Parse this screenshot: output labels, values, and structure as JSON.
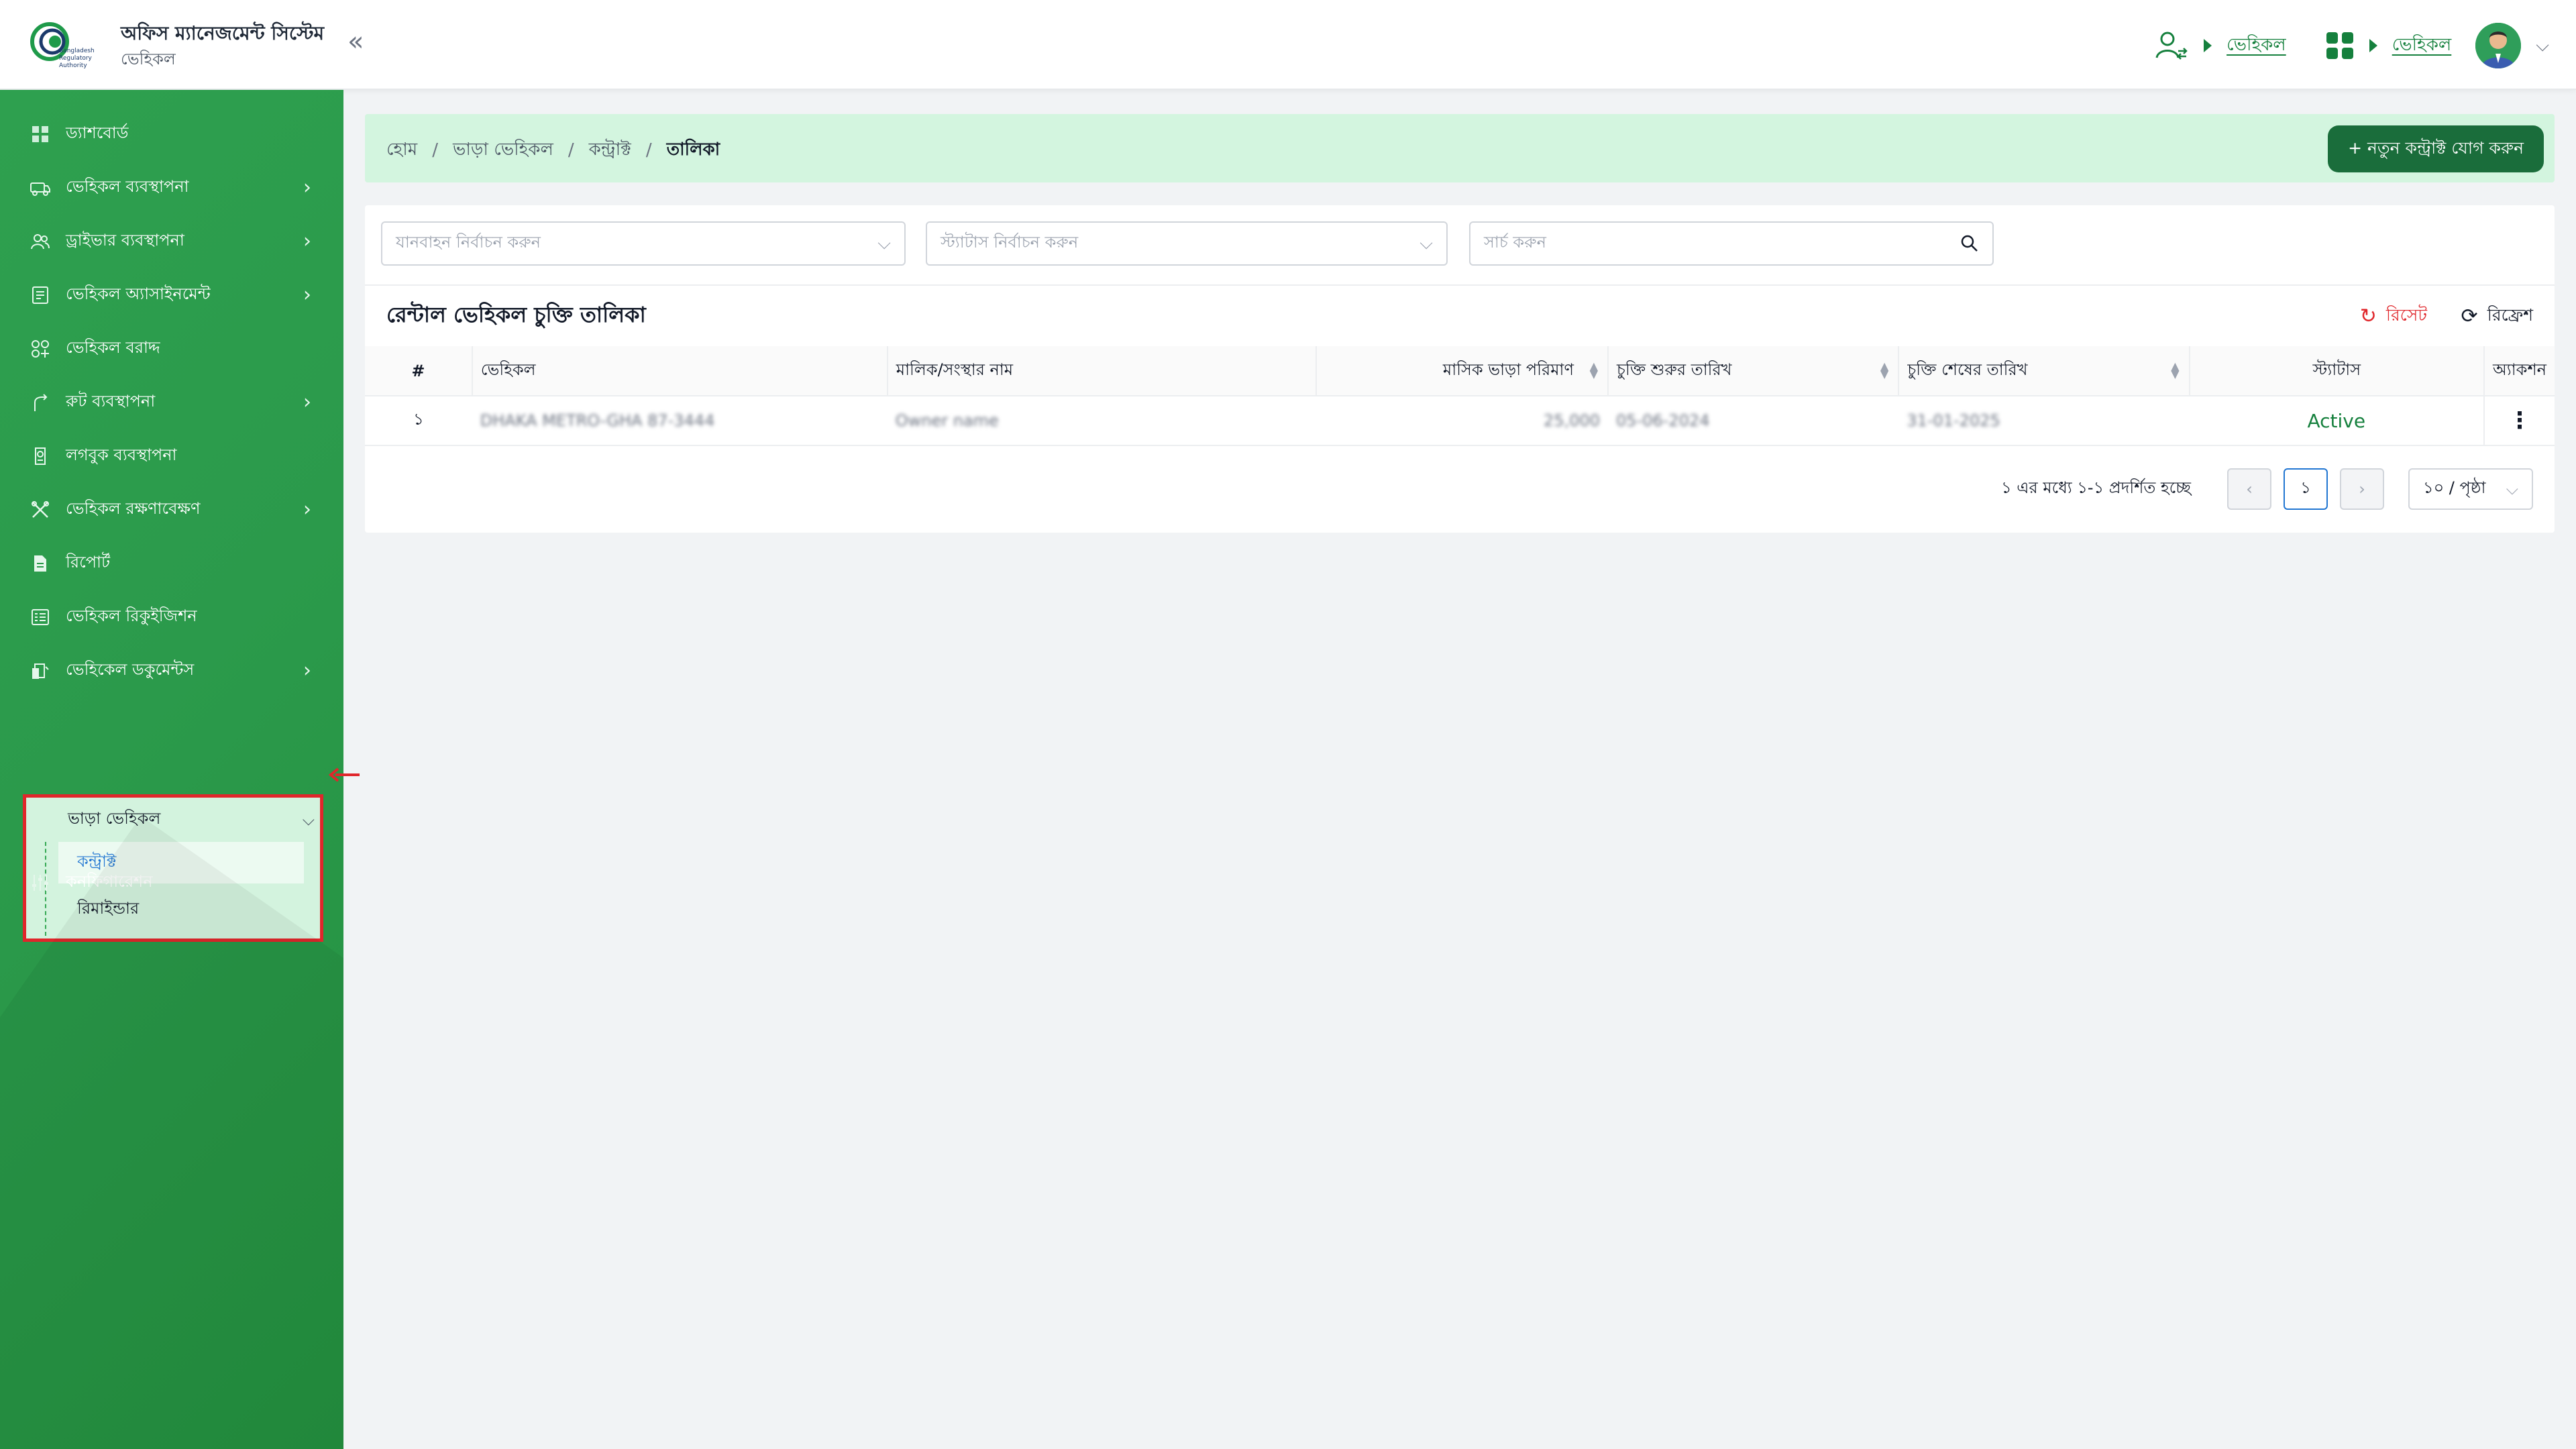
{
  "app": {
    "title": "অফিস ম্যানেজমেন্ট সিস্টেম",
    "subtitle": "ভেহিকল",
    "logo_text": [
      "Bangladesh",
      "Regulatory",
      "Authority"
    ]
  },
  "header": {
    "link1": "ভেহিকল",
    "link2": "ভেহিকল",
    "accent": "#15803d"
  },
  "sidebar": {
    "items": [
      {
        "label": "ড্যাশবোর্ড",
        "icon": "dashboard-icon"
      },
      {
        "label": "ভেহিকল ব্যবস্থাপনা",
        "icon": "car-icon"
      },
      {
        "label": "ড্রাইভার ব্যবস্থাপনা",
        "icon": "users-icon"
      },
      {
        "label": "ভেহিকল অ্যাসাইনমেন্ট",
        "icon": "clipboard-icon"
      },
      {
        "label": "ভেহিকল বরাদ্দ",
        "icon": "grid-plus-icon"
      },
      {
        "label": "রুট ব্যবস্থাপনা",
        "icon": "route-icon"
      },
      {
        "label": "লগবুক ব্যবস্থাপনা",
        "icon": "logbook-icon"
      },
      {
        "label": "ভেহিকল রক্ষণাবেক্ষণ",
        "icon": "tools-icon"
      },
      {
        "label": "রিপোর্ট",
        "icon": "report-icon"
      },
      {
        "label": "ভেহিকল রিকুইজিশন",
        "icon": "requisition-icon"
      },
      {
        "label": "ভেহিকেল ডকুমেন্টস",
        "icon": "documents-icon"
      }
    ],
    "rental": {
      "label": "ভাড়া ভেহিকল",
      "sub": [
        "কন্ট্রাক্ট",
        "রিমাইন্ডার"
      ]
    },
    "config": "কনফিগারেশন"
  },
  "breadcrumb": [
    "হোম",
    "ভাড়া ভেহিকল",
    "কন্ট্রাক্ট",
    "তালিকা"
  ],
  "add_button": "+ নতুন কন্ট্রাক্ট যোগ করুন",
  "filters": {
    "vehicle_placeholder": "যানবাহন নির্বাচন করুন",
    "status_placeholder": "স্ট্যাটাস নির্বাচন করুন",
    "search_placeholder": "সার্চ করুন"
  },
  "table": {
    "title": "রেন্টাল ভেহিকল চুক্তি তালিকা",
    "reset": "রিসেট",
    "refresh": "রিফ্রেশ",
    "columns": [
      "#",
      "ভেহিকল",
      "মালিক/সংস্থার নাম",
      "মাসিক ভাড়া পরিমাণ",
      "চুক্তি শুরুর তারিখ",
      "চুক্তি শেষের তারিখ",
      "স্ট্যাটাস",
      "অ্যাকশন"
    ],
    "rows": [
      {
        "num": "১",
        "vehicle": "DHAKA METRO-GHA 87-3444",
        "owner": "Owner name",
        "rent": "25,000",
        "start": "05-06-2024",
        "end": "31-01-2025",
        "status": "Active"
      }
    ]
  },
  "pagination": {
    "summary": "১ এর মধ্যে ১-১ প্রদর্শিত হচ্ছে",
    "current_page": "১",
    "page_size": "১০ / পৃষ্ঠা"
  }
}
